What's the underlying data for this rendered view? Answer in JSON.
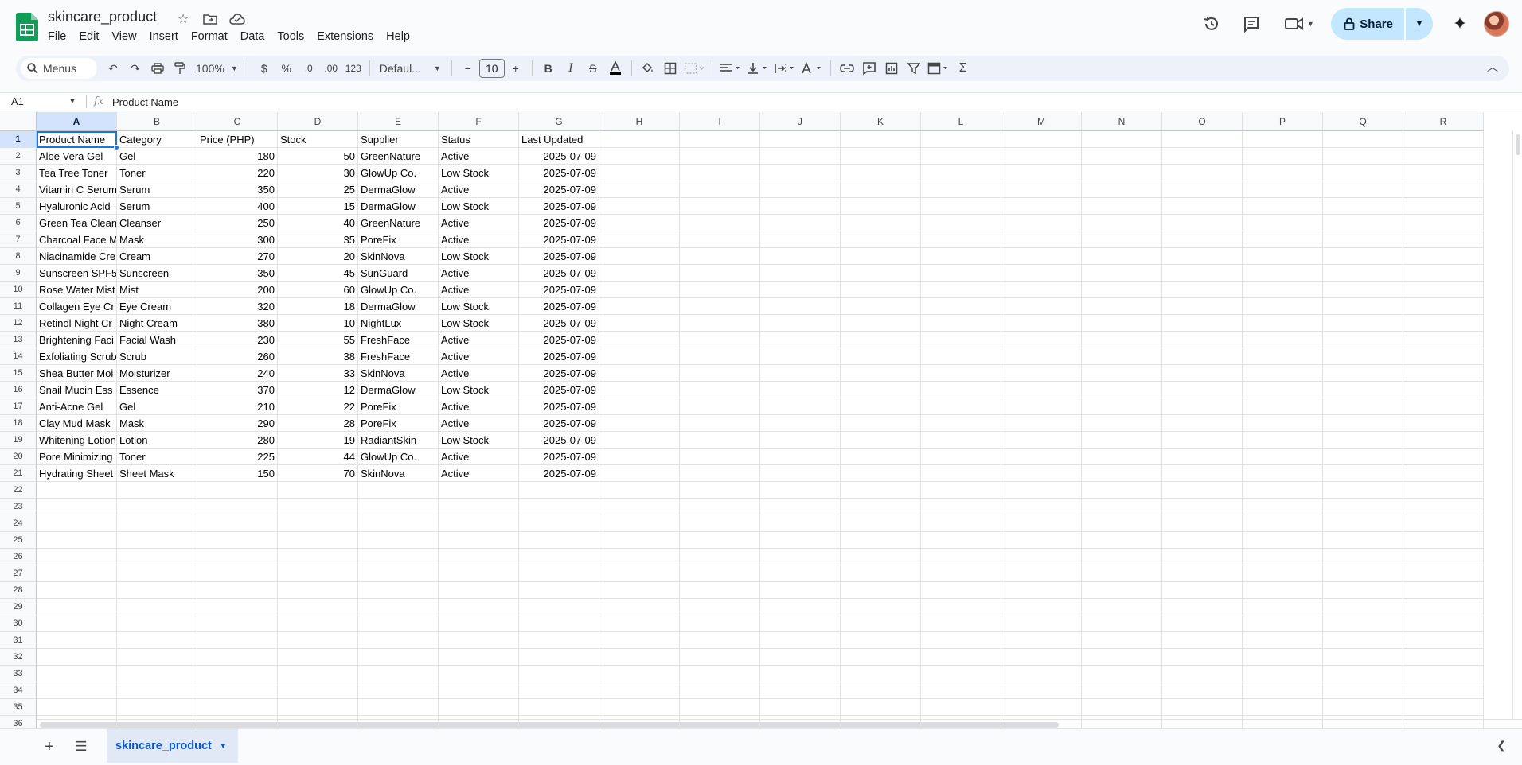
{
  "app": {
    "title": "skincare_product",
    "menus": [
      "File",
      "Edit",
      "View",
      "Insert",
      "Format",
      "Data",
      "Tools",
      "Extensions",
      "Help"
    ],
    "share_label": "Share"
  },
  "toolbar": {
    "search_label": "Menus",
    "zoom": "100%",
    "currency": "$",
    "percent": "%",
    "dec_decrease": ".0",
    "dec_increase": ".00",
    "number_format": "123",
    "font": "Defaul...",
    "font_size": "10"
  },
  "formula_bar": {
    "cell_ref": "A1",
    "fx": "fx",
    "content": "Product Name"
  },
  "sheet": {
    "columns": [
      "A",
      "B",
      "C",
      "D",
      "E",
      "F",
      "G",
      "H",
      "I",
      "J",
      "K",
      "L",
      "M",
      "N",
      "O",
      "P",
      "Q",
      "R"
    ],
    "row_numbers": [
      "1",
      "2",
      "3",
      "4",
      "5",
      "6",
      "7",
      "8",
      "9",
      "10",
      "11",
      "12",
      "13",
      "14",
      "15",
      "16",
      "17",
      "18",
      "19",
      "20",
      "21",
      "22",
      "23",
      "24",
      "25",
      "26",
      "27",
      "28",
      "29",
      "30",
      "31",
      "32",
      "33",
      "34",
      "35",
      "36"
    ],
    "selected_cell": "A1",
    "header": [
      "Product Name",
      "Category",
      "Price (PHP)",
      "Stock",
      "Supplier",
      "Status",
      "Last Updated"
    ],
    "rows": [
      [
        "Aloe Vera Gel",
        "Gel",
        "180",
        "50",
        "GreenNature",
        "Active",
        "2025-07-09"
      ],
      [
        "Tea Tree Toner",
        "Toner",
        "220",
        "30",
        "GlowUp Co.",
        "Low Stock",
        "2025-07-09"
      ],
      [
        "Vitamin C Serum",
        "Serum",
        "350",
        "25",
        "DermaGlow",
        "Active",
        "2025-07-09"
      ],
      [
        "Hyaluronic Acid",
        "Serum",
        "400",
        "15",
        "DermaGlow",
        "Low Stock",
        "2025-07-09"
      ],
      [
        "Green Tea Clean",
        "Cleanser",
        "250",
        "40",
        "GreenNature",
        "Active",
        "2025-07-09"
      ],
      [
        "Charcoal Face M",
        "Mask",
        "300",
        "35",
        "PoreFix",
        "Active",
        "2025-07-09"
      ],
      [
        "Niacinamide Cre",
        "Cream",
        "270",
        "20",
        "SkinNova",
        "Low Stock",
        "2025-07-09"
      ],
      [
        "Sunscreen SPF5",
        "Sunscreen",
        "350",
        "45",
        "SunGuard",
        "Active",
        "2025-07-09"
      ],
      [
        "Rose Water Mist",
        "Mist",
        "200",
        "60",
        "GlowUp Co.",
        "Active",
        "2025-07-09"
      ],
      [
        "Collagen Eye Cr",
        "Eye Cream",
        "320",
        "18",
        "DermaGlow",
        "Low Stock",
        "2025-07-09"
      ],
      [
        "Retinol Night Cr",
        "Night Cream",
        "380",
        "10",
        "NightLux",
        "Low Stock",
        "2025-07-09"
      ],
      [
        "Brightening Faci",
        "Facial Wash",
        "230",
        "55",
        "FreshFace",
        "Active",
        "2025-07-09"
      ],
      [
        "Exfoliating Scrub",
        "Scrub",
        "260",
        "38",
        "FreshFace",
        "Active",
        "2025-07-09"
      ],
      [
        "Shea Butter Moi",
        "Moisturizer",
        "240",
        "33",
        "SkinNova",
        "Active",
        "2025-07-09"
      ],
      [
        "Snail Mucin Ess",
        "Essence",
        "370",
        "12",
        "DermaGlow",
        "Low Stock",
        "2025-07-09"
      ],
      [
        "Anti-Acne Gel",
        "Gel",
        "210",
        "22",
        "PoreFix",
        "Active",
        "2025-07-09"
      ],
      [
        "Clay Mud Mask",
        "Mask",
        "290",
        "28",
        "PoreFix",
        "Active",
        "2025-07-09"
      ],
      [
        "Whitening Lotion",
        "Lotion",
        "280",
        "19",
        "RadiantSkin",
        "Low Stock",
        "2025-07-09"
      ],
      [
        "Pore Minimizing",
        "Toner",
        "225",
        "44",
        "GlowUp Co.",
        "Active",
        "2025-07-09"
      ],
      [
        "Hydrating Sheet",
        "Sheet Mask",
        "150",
        "70",
        "SkinNova",
        "Active",
        "2025-07-09"
      ]
    ]
  },
  "sheet_tabs": [
    {
      "label": "skincare_product",
      "active": true
    }
  ],
  "colors": {
    "accent": "#1a73e8",
    "share_bg": "#c2e7ff",
    "toolbar_bg": "#edf2fa",
    "selected_header": "#d3e3fd",
    "sheets_green": "#0f9d58"
  }
}
